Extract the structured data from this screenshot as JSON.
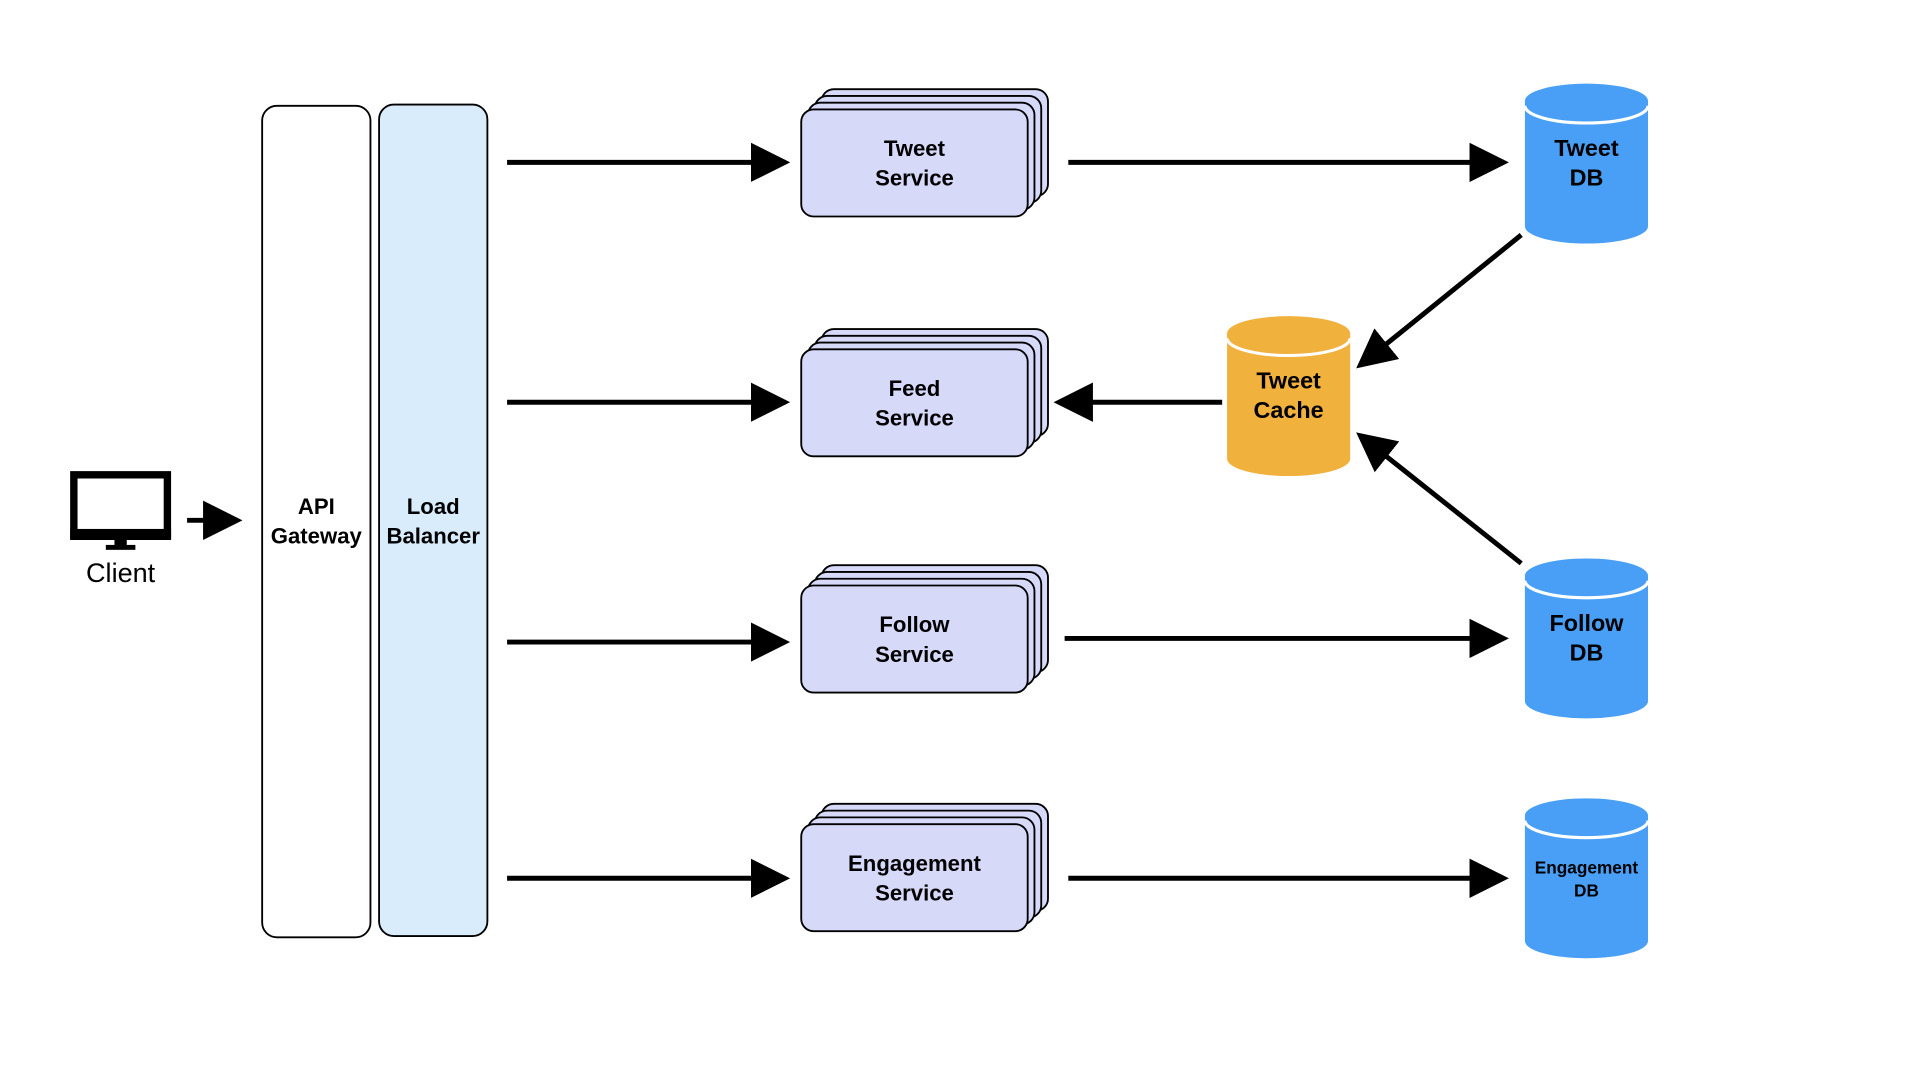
{
  "client": {
    "label": "Client",
    "icon": "monitor-icon"
  },
  "api_gateway": {
    "label_lines": [
      "API",
      "Gateway"
    ]
  },
  "load_balancer": {
    "label_lines": [
      "Load",
      "Balancer"
    ]
  },
  "services": [
    {
      "label_lines": [
        "Tweet",
        "Service"
      ]
    },
    {
      "label_lines": [
        "Feed",
        "Service"
      ]
    },
    {
      "label_lines": [
        "Follow",
        "Service"
      ]
    },
    {
      "label_lines": [
        "Engagement",
        "Service"
      ]
    }
  ],
  "tweet_db": {
    "label_lines": [
      "Tweet",
      "DB"
    ]
  },
  "tweet_cache": {
    "label_lines": [
      "Tweet",
      "Cache"
    ]
  },
  "follow_db": {
    "label_lines": [
      "Follow",
      "DB"
    ]
  },
  "engagement_db": {
    "label_lines": [
      "Engagement",
      "DB"
    ]
  },
  "colors": {
    "service_fill": "#d6d9f8",
    "load_balancer_fill": "#d9ecfc",
    "db_fill": "#489ff5",
    "cache_fill": "#f0b13d"
  }
}
